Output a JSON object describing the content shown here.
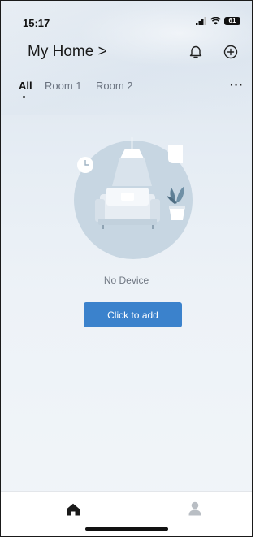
{
  "status_bar": {
    "time": "15:17",
    "battery": "61"
  },
  "header": {
    "title": "My Home >"
  },
  "tabs": [
    {
      "label": "All"
    },
    {
      "label": "Room 1"
    },
    {
      "label": "Room 2"
    }
  ],
  "more_label": "···",
  "empty_state": {
    "message": "No Device",
    "button_label": "Click to add"
  },
  "colors": {
    "accent": "#3b82cc",
    "illustration_bg": "#c7d6e2"
  },
  "bottom_nav": {
    "active": "home",
    "items": [
      "home-icon",
      "person-icon"
    ]
  }
}
